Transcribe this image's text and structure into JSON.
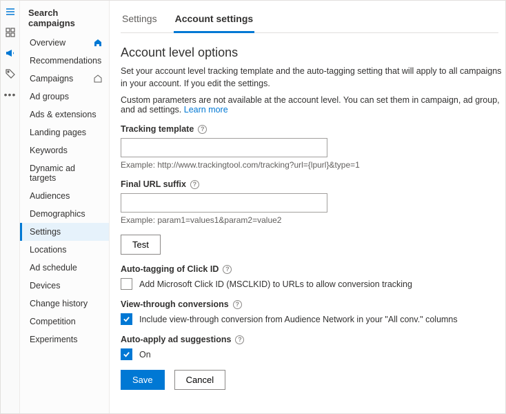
{
  "sidebar": {
    "title": "Search campaigns",
    "items": [
      {
        "label": "Overview"
      },
      {
        "label": "Recommendations"
      },
      {
        "label": "Campaigns"
      },
      {
        "label": "Ad groups"
      },
      {
        "label": "Ads & extensions"
      },
      {
        "label": "Landing pages"
      },
      {
        "label": "Keywords"
      },
      {
        "label": "Dynamic ad targets"
      },
      {
        "label": "Audiences"
      },
      {
        "label": "Demographics"
      },
      {
        "label": "Settings"
      },
      {
        "label": "Locations"
      },
      {
        "label": "Ad schedule"
      },
      {
        "label": "Devices"
      },
      {
        "label": "Change history"
      },
      {
        "label": "Competition"
      },
      {
        "label": "Experiments"
      }
    ]
  },
  "tabs": {
    "settings": "Settings",
    "account_settings": "Account settings"
  },
  "section": {
    "title": "Account level options",
    "desc": "Set your account level tracking template and the auto-tagging setting that will apply to all campaigns in your account. If you edit the settings.",
    "note": "Custom parameters are not available at the account level. You can set them in campaign, ad group, and ad settings.",
    "learn_more": "Learn more"
  },
  "tracking": {
    "label": "Tracking template",
    "value": "",
    "example": "Example: http://www.trackingtool.com/tracking?url={lpurl}&type=1"
  },
  "suffix": {
    "label": "Final URL suffix",
    "value": "",
    "example": "Example: param1=values1&param2=value2"
  },
  "test_btn": "Test",
  "autotag": {
    "label": "Auto-tagging of Click ID",
    "cb_label": "Add Microsoft Click ID (MSCLKID) to URLs to allow conversion tracking"
  },
  "vtc": {
    "label": "View-through conversions",
    "cb_label": "Include view-through conversion from Audience Network in your \"All conv.\" columns"
  },
  "autoapply": {
    "label": "Auto-apply ad suggestions",
    "cb_label": "On"
  },
  "buttons": {
    "save": "Save",
    "cancel": "Cancel"
  }
}
